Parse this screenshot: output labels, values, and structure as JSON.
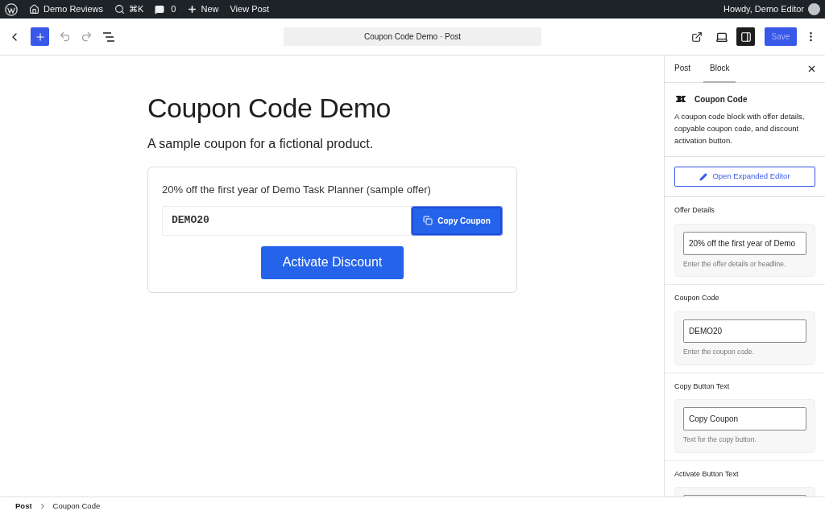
{
  "admin_bar": {
    "site": "Demo Reviews",
    "shortcut": "⌘K",
    "comments": "0",
    "new_label": "New",
    "view_label": "View Post",
    "greeting": "Howdy, Demo Editor"
  },
  "toolbar": {
    "document_title": "Coupon Code Demo · Post",
    "sidebar_open": true,
    "save": {
      "label": "Save",
      "disabled": true
    }
  },
  "editor": {
    "title": "Coupon Code Demo",
    "subtitle": "A sample coupon for a fictional product.",
    "coupon": {
      "offer": "20% off the first year of Demo Task Planner (sample offer)",
      "code": "DEMO20",
      "copy_label": "Copy Coupon",
      "activate_label": "Activate Discount"
    }
  },
  "sidebar": {
    "tabs": [
      {
        "label": "Post",
        "selected": false
      },
      {
        "label": "Block",
        "selected": true
      }
    ],
    "block": {
      "name": "Coupon Code",
      "description": "A coupon code block with offer details, copyable coupon code, and discount activation button."
    },
    "expanded_editor_button": "Open Expanded Editor",
    "settings": [
      {
        "label": "Offer Details",
        "value": "20% off the first year of Demo",
        "help": "Enter the offer details or headline."
      },
      {
        "label": "Coupon Code",
        "value": "DEMO20",
        "help": "Enter the coupon code."
      },
      {
        "label": "Copy Button Text",
        "value": "Copy Coupon",
        "help": "Text for the copy button."
      },
      {
        "label": "Activate Button Text"
      }
    ]
  },
  "breadcrumb": [
    "Post",
    "Coupon Code"
  ]
}
